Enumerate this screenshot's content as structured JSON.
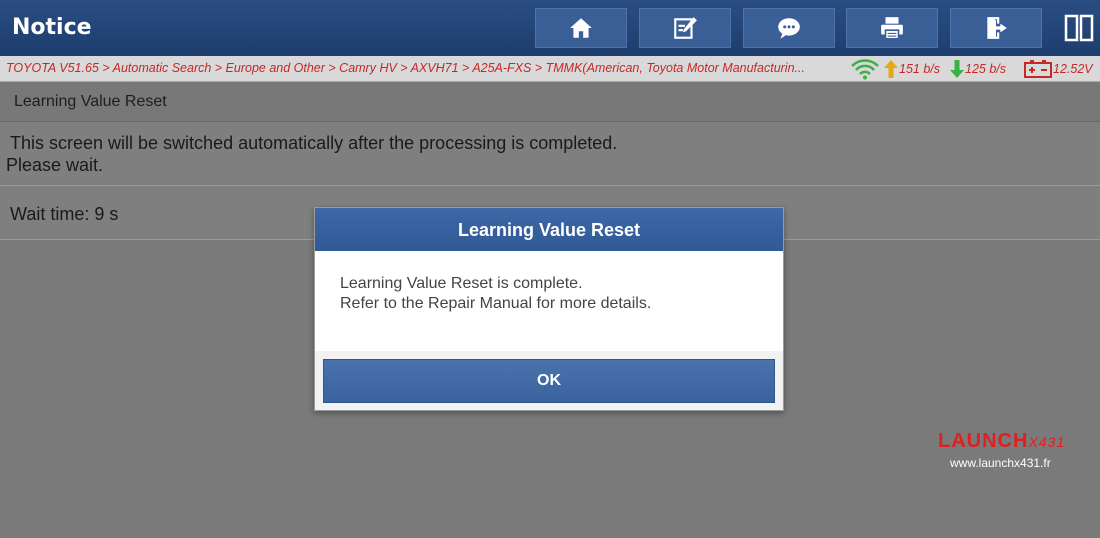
{
  "header": {
    "title": "Notice",
    "toolbar": [
      {
        "name": "home-button",
        "icon": "home-icon"
      },
      {
        "name": "edit-report-button",
        "icon": "edit-icon"
      },
      {
        "name": "message-button",
        "icon": "chat-icon"
      },
      {
        "name": "print-button",
        "icon": "printer-icon"
      },
      {
        "name": "exit-button",
        "icon": "exit-icon"
      }
    ],
    "layout_icon": "split-view-icon"
  },
  "statusbar": {
    "breadcrumb": "TOYOTA V51.65 > Automatic Search > Europe and Other > Camry HV > AXVH71 > A25A-FXS > TMMK(American, Toyota Motor Manufacturin...",
    "upload_rate": "151 b/s",
    "download_rate": "125 b/s",
    "battery_voltage": "12.52V",
    "colors": {
      "text": "#c62828",
      "wifi": "#3cb043",
      "upload_arrow": "#e6a817",
      "download_arrow": "#3cb043"
    }
  },
  "panel": {
    "title": "Learning Value Reset",
    "notice_line1": "This screen will be switched automatically after the processing is completed.",
    "notice_line2": "Please wait.",
    "wait_time": "Wait time: 9 s"
  },
  "dialog": {
    "title": "Learning Value Reset",
    "message_line1": "Learning Value Reset is complete.",
    "message_line2": "Refer to the Repair Manual for more details.",
    "ok_label": "OK"
  },
  "watermark": {
    "logo": "LAUNCH",
    "logo_suffix": "X431",
    "url": "www.launchx431.fr"
  }
}
